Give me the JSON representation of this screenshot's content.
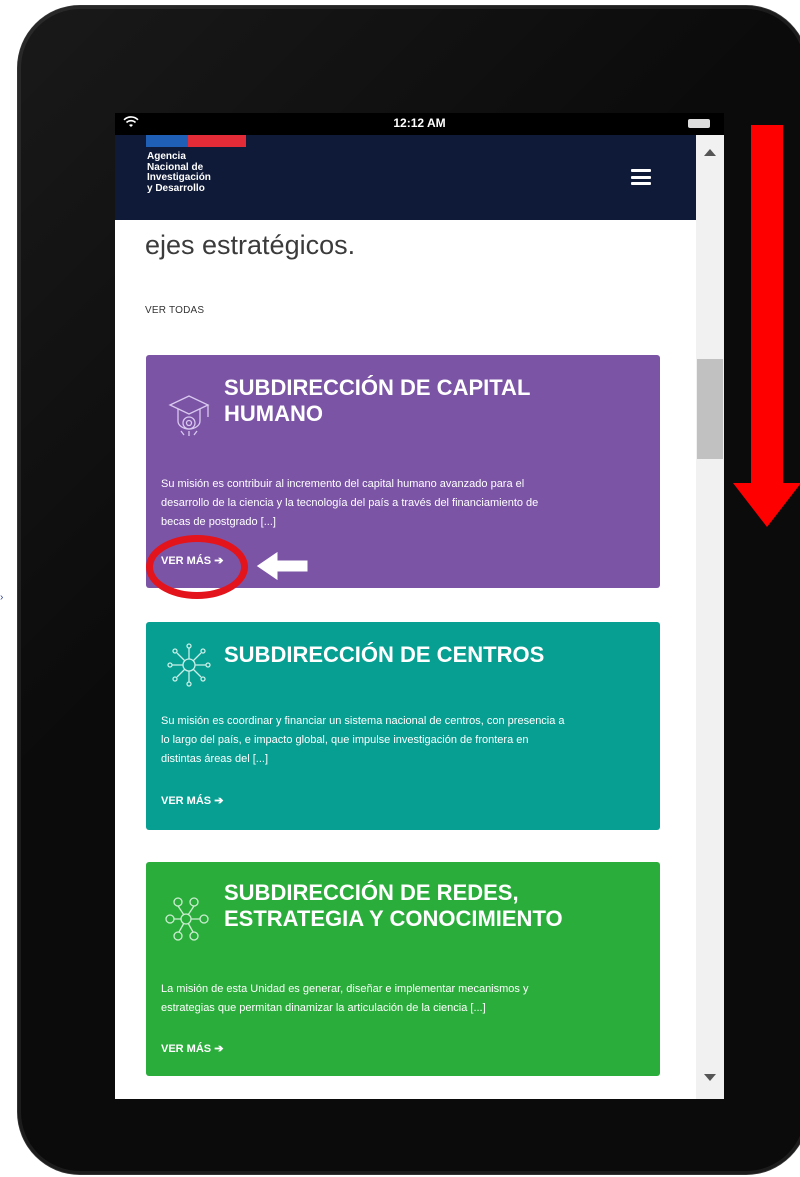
{
  "statusbar": {
    "time": "12:12 AM"
  },
  "header": {
    "logo_lines": [
      "Agencia",
      "Nacional de",
      "Investigación",
      "y Desarrollo"
    ],
    "flag_colors": [
      "#1f5fb5",
      "#e22b36"
    ],
    "background": "#0f1a38"
  },
  "section": {
    "heading": "ejes estratégicos.",
    "see_all": "VER TODAS"
  },
  "cards": [
    {
      "title_lines": [
        "SUBDIRECCIÓN DE CAPITAL",
        "HUMANO"
      ],
      "description_lines": [
        "Su misión es contribuir al incremento del capital humano avanzado para el",
        "desarrollo de la ciencia y la tecnología del país a través del financiamiento de",
        "becas de postgrado [...]"
      ],
      "link": "VER MÁS",
      "icon": "graduate-head-icon",
      "color": "#7b54a6"
    },
    {
      "title_lines": [
        "SUBDIRECCIÓN DE CENTROS"
      ],
      "description_lines": [
        "Su misión es coordinar y financiar un sistema nacional de centros, con presencia a",
        "lo largo del país, e impacto global, que impulse investigación de frontera en",
        "distintas áreas del [...]"
      ],
      "link": "VER MÁS",
      "icon": "network-virus-icon",
      "color": "#079f92"
    },
    {
      "title_lines": [
        "SUBDIRECCIÓN DE REDES,",
        "ESTRATEGIA Y CONOCIMIENTO"
      ],
      "description_lines": [
        "La misión de esta Unidad es generar, diseñar e implementar mecanismos y",
        "estrategias que permitan dinamizar la articulación de la ciencia [...]"
      ],
      "link": "VER MÁS",
      "icon": "nodes-network-icon",
      "color": "#2aad3b"
    }
  ],
  "annotations": {
    "scroll_arrow_color": "#ff0000",
    "highlight_color": "#e3141b"
  }
}
